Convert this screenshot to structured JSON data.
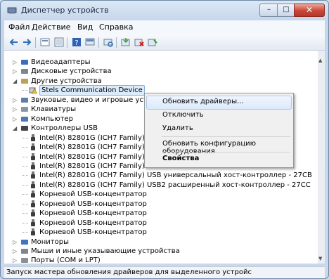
{
  "window": {
    "title": "Диспетчер устройств",
    "controls": {
      "minimize": "–",
      "maximize": "□",
      "close": "✕"
    }
  },
  "menubar": {
    "items": [
      "Файл",
      "Действие",
      "Вид",
      "Справка"
    ]
  },
  "toolbar": {
    "buttons": [
      "back-icon",
      "forward-icon",
      "properties-icon",
      "show-hidden-icon",
      "help-icon",
      "device-list-icon",
      "scan-hardware-icon",
      "update-driver-icon",
      "uninstall-icon",
      "disable-icon"
    ]
  },
  "tree": {
    "items": [
      {
        "label": "Видеоадаптеры",
        "expander": "▷",
        "icon": "display-adapter-icon"
      },
      {
        "label": "Дисковые устройства",
        "expander": "▷",
        "icon": "disk-drive-icon"
      },
      {
        "label": "Другие устройства",
        "expander": "◢",
        "icon": "other-devices-icon"
      },
      {
        "label": "Stels Communication Device",
        "expander": "",
        "icon": "unknown-device-warning-icon"
      },
      {
        "label": "Звуковые, видео и игровые устр",
        "expander": "▷",
        "icon": "sound-icon"
      },
      {
        "label": "Клавиатуры",
        "expander": "▷",
        "icon": "keyboard-icon"
      },
      {
        "label": "Компьютер",
        "expander": "▷",
        "icon": "computer-icon"
      },
      {
        "label": "Контроллеры USB",
        "expander": "◢",
        "icon": "usb-icon"
      },
      {
        "label": "Intel(R) 82801G (ICH7 Family)",
        "expander": "",
        "icon": "usb-plug-icon"
      },
      {
        "label": "Intel(R) 82801G (ICH7 Family)",
        "expander": "",
        "icon": "usb-plug-icon"
      },
      {
        "label": "Intel(R) 82801G (ICH7 Family)",
        "expander": "",
        "icon": "usb-plug-icon"
      },
      {
        "label": "Intel(R) 82801G (ICH7 Family)",
        "expander": "",
        "icon": "usb-plug-icon"
      },
      {
        "label": "Intel(R) 82801G (ICH7 Family) USB универсальный хост-контроллер - 27CB",
        "expander": "",
        "icon": "usb-plug-icon"
      },
      {
        "label": "Intel(R) 82801G (ICH7 Family) USB2 расширенный хост-контроллер - 27CC",
        "expander": "",
        "icon": "usb-plug-icon"
      },
      {
        "label": "Корневой USB-концентратор",
        "expander": "",
        "icon": "usb-plug-icon"
      },
      {
        "label": "Корневой USB-концентратор",
        "expander": "",
        "icon": "usb-plug-icon"
      },
      {
        "label": "Корневой USB-концентратор",
        "expander": "",
        "icon": "usb-plug-icon"
      },
      {
        "label": "Корневой USB-концентратор",
        "expander": "",
        "icon": "usb-plug-icon"
      },
      {
        "label": "Корневой USB-концентратор",
        "expander": "",
        "icon": "usb-plug-icon"
      },
      {
        "label": "Мониторы",
        "expander": "▷",
        "icon": "monitor-icon"
      },
      {
        "label": "Мыши и иные указывающие устройства",
        "expander": "▷",
        "icon": "mouse-icon"
      },
      {
        "label": "Порты (COM и LPT)",
        "expander": "▷",
        "icon": "port-icon"
      }
    ]
  },
  "context_menu": {
    "items": [
      "Обновить драйверы...",
      "Отключить",
      "Удалить",
      "Обновить конфигурацию оборудования",
      "Свойства"
    ]
  },
  "status_bar": {
    "text": "Запуск мастера обновления драйверов для выделенного устройс"
  },
  "scrollbar": {
    "up": "▲",
    "down": "▼"
  }
}
